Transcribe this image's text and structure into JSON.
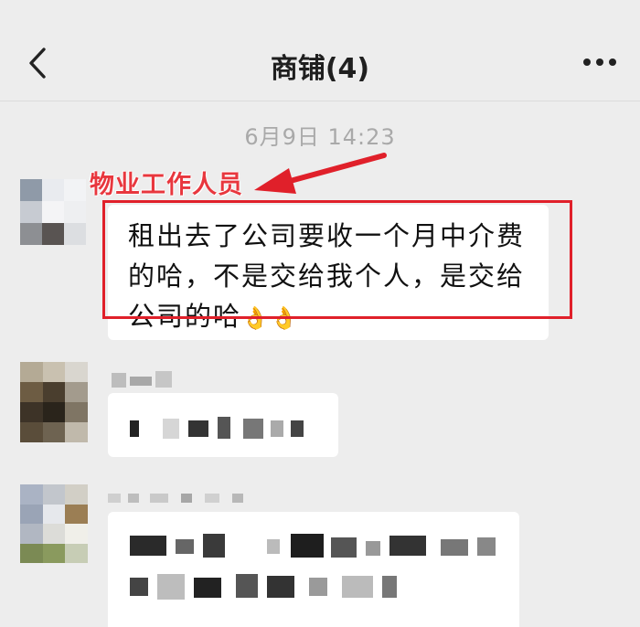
{
  "header": {
    "title": "商铺(4)",
    "back_icon": "chevron-left-icon",
    "more_icon": "more-dots-icon"
  },
  "timestamp": "6月9日 14:23",
  "annotation": {
    "label": "物业工作人员",
    "color": "#e0202a"
  },
  "messages": [
    {
      "text_lines": [
        "租出去了公司要收一个月中介费",
        "的哈，不是交给我个人，是交给",
        "公司的哈"
      ],
      "emoji": "👌👌"
    },
    {
      "obscured": true
    },
    {
      "obscured": true
    }
  ]
}
